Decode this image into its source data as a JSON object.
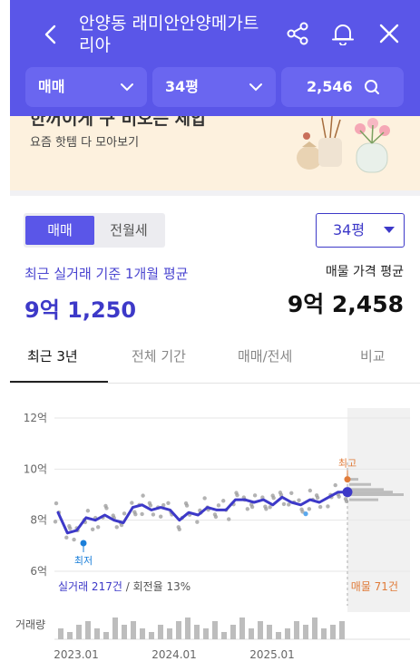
{
  "header": {
    "title": "안양동 래미안안양메가트리아",
    "filters": {
      "trade_type": "매매",
      "size": "34평",
      "listing_count": "2,546"
    }
  },
  "banner": {
    "headline": "한꺼이게 구 비오는 제압",
    "subtext": "요즘 핫템 다 모아보기"
  },
  "toggle": {
    "sale": "매매",
    "rent": "전월세"
  },
  "size_select": "34평",
  "summary": {
    "actual_label": "최근 실거래 기준 1개월 평균",
    "actual_value": "9억 1,250",
    "listing_label": "매물 가격 평균",
    "listing_value": "9억 2,458"
  },
  "tabs": [
    "최근 3년",
    "전체 기간",
    "매매/전세",
    "비교"
  ],
  "chart_data": {
    "type": "line",
    "y_ticks": [
      "12억",
      "10억",
      "8억",
      "6억"
    ],
    "ylim": [
      6,
      12
    ],
    "x_ticks": [
      "2023.01",
      "2024.01",
      "2025.01"
    ],
    "series": [
      {
        "values": [
          8.3,
          7.5,
          7.6,
          8.1,
          8.0,
          8.2,
          8.0,
          7.9,
          8.5,
          8.6,
          8.4,
          8.5,
          8.4,
          8.0,
          8.3,
          8.2,
          8.5,
          8.4,
          8.4,
          8.8,
          8.8,
          8.7,
          8.8,
          8.6,
          8.9,
          8.7,
          8.6,
          8.8,
          8.7,
          8.9,
          9.1,
          9.1
        ]
      }
    ],
    "annotations": {
      "max_label": "최고",
      "min_label": "최저",
      "min_value": 7.1,
      "max_value": 9.6
    },
    "volume": [
      3,
      2,
      4,
      5,
      3,
      2,
      6,
      4,
      5,
      3,
      2,
      4,
      3,
      5,
      6,
      4,
      3,
      5,
      2,
      4,
      6,
      3,
      5,
      4,
      2,
      3,
      5,
      4,
      6,
      3,
      4,
      5
    ]
  },
  "stats": {
    "deals": "실거래 217건",
    "turnover": "/ 회전율 13%",
    "listings": "매물 71건",
    "volume_label": "거래량"
  },
  "colors": {
    "primary": "#5a56e8",
    "line": "#3d39c8",
    "listing": "#e07b39",
    "low": "#1b7fd9"
  }
}
